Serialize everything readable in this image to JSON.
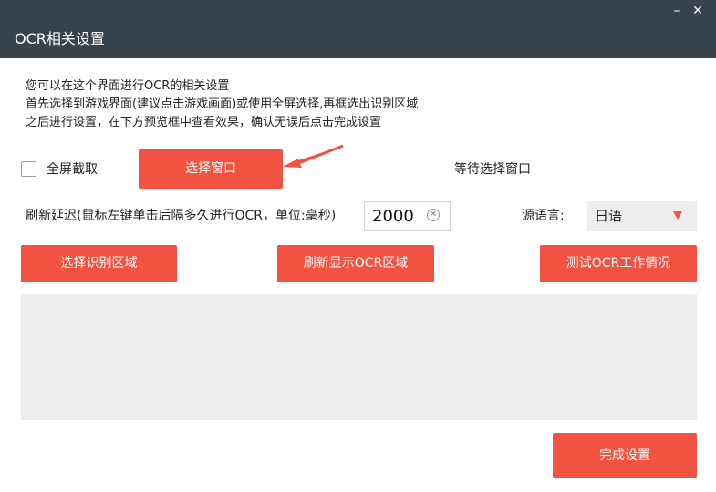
{
  "window": {
    "title": "OCR相关设置",
    "minimize_label": "–",
    "close_label": "✕"
  },
  "description": {
    "line1": "您可以在这个界面进行OCR的相关设置",
    "line2": "首先选择到游戏界面(建议点击游戏画面)或使用全屏选择,再框选出识别区域",
    "line3": "之后进行设置，在下方预览框中查看效果，确认无误后点击完成设置"
  },
  "fullscreen": {
    "label": "全屏截取",
    "checked": false
  },
  "select_window_button": "选择窗口",
  "status_text": "等待选择窗口",
  "delay": {
    "label": "刷新延迟(鼠标左键单击后隔多久进行OCR，单位:毫秒)",
    "value": "2000"
  },
  "source_language": {
    "label": "源语言:",
    "selected": "日语"
  },
  "buttons": {
    "select_region": "选择识别区域",
    "refresh_region": "刷新显示OCR区域",
    "test_ocr": "测试OCR工作情况",
    "finish": "完成设置"
  },
  "colors": {
    "titlebar": "#39434d",
    "accent": "#f25241",
    "panel": "#eeeeee"
  },
  "icons": {
    "arrow": "red-pointer-arrow",
    "clear": "clear-circle-icon",
    "dropdown": "triangle-down-icon"
  }
}
